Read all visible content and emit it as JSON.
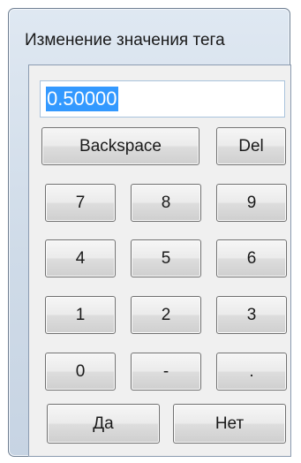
{
  "window": {
    "title": "Изменение значения тега"
  },
  "input": {
    "value": "0.50000"
  },
  "buttons": {
    "backspace": "Backspace",
    "del": "Del",
    "d7": "7",
    "d8": "8",
    "d9": "9",
    "d4": "4",
    "d5": "5",
    "d6": "6",
    "d1": "1",
    "d2": "2",
    "d3": "3",
    "d0": "0",
    "minus": "-",
    "dot": ".",
    "ok": "Да",
    "cancel": "Нет"
  }
}
